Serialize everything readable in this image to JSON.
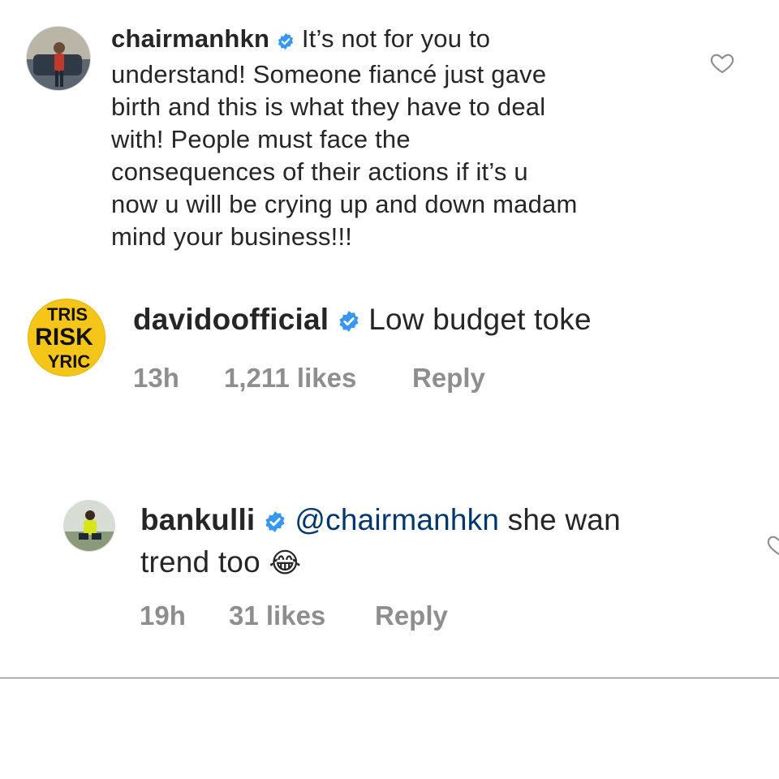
{
  "comments": [
    {
      "username": "chairmanhkn",
      "verified": true,
      "lines": [
        "It’s not for you to",
        "understand! Someone fiancé just gave",
        "birth and this is what they have to deal",
        "with! People must face the",
        "consequences of their actions if it’s u",
        "now u will be crying up and down madam",
        "mind your business!!!"
      ]
    },
    {
      "username": "davidoofficial",
      "verified": true,
      "text": "Low budget toke",
      "time": "13h",
      "likes": "1,211 likes",
      "reply": "Reply",
      "avatar_text": [
        "TRIS",
        "RISK",
        "YRIC"
      ]
    },
    {
      "username": "bankulli",
      "verified": true,
      "mention": "@chairmanhkn",
      "text_after_mention": "she wan",
      "line2": "trend too",
      "emoji": "😂",
      "time": "19h",
      "likes": "31 likes",
      "reply": "Reply"
    }
  ],
  "colors": {
    "text": "#262626",
    "meta": "#8e8e8e",
    "verified": "#3897f0",
    "mention": "#00376b"
  }
}
